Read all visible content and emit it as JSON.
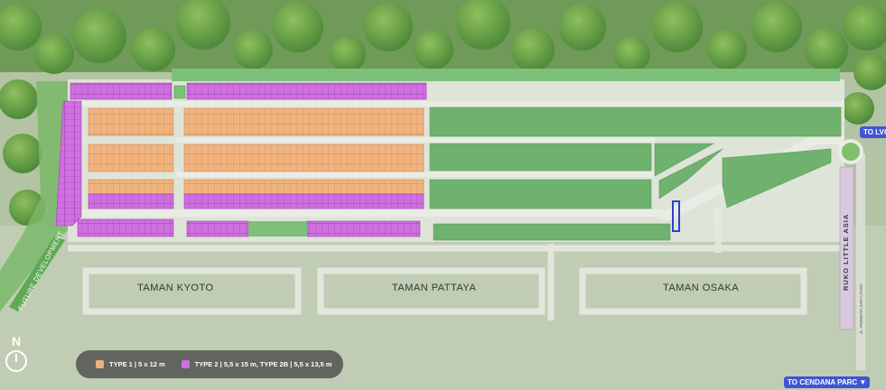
{
  "areas": {
    "kyoto": "TAMAN KYOTO",
    "pattaya": "TAMAN PATTAYA",
    "osaka": "TAMAN OSAKA"
  },
  "side_labels": {
    "future": "FUTURE DEVELOPMENT",
    "ruko": "RUKO LITTLE ASIA",
    "permata": "JL. PERMATA SARI UTARA"
  },
  "badges": {
    "lvc": "TO LVC",
    "cendana": "TO CENDANA PARC ▼"
  },
  "legend": {
    "type1": "TYPE 1 | 5 x 12 m",
    "type2": "TYPE 2 | 5,5 x 15 m, TYPE 2B | 5,5 x 13,5 m"
  },
  "compass": "N",
  "colors": {
    "type1": "#f0b27a",
    "type2": "#cf6fe0",
    "green": "#6fb26f",
    "road": "#d6dcd0",
    "highlight": "#2f3fd1"
  }
}
